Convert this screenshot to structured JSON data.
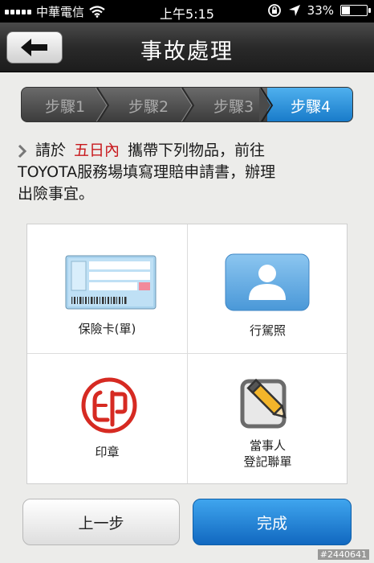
{
  "status_bar": {
    "carrier": "中華電信",
    "time": "上午5:15",
    "battery": "33%",
    "battery_level": 0.33
  },
  "navbar": {
    "title": "事故處理",
    "back_icon": "arrow-left-icon"
  },
  "steps": [
    {
      "label": "步驟1",
      "active": false
    },
    {
      "label": "步驟2",
      "active": false
    },
    {
      "label": "步驟3",
      "active": false
    },
    {
      "label": "步驟4",
      "active": true
    }
  ],
  "instruction": {
    "prefix": "請於",
    "highlight": "五日內",
    "after": "攜帶下列物品，前往",
    "line2": "TOYOTA服務場填寫理賠申請書，辦理",
    "line3": "出險事宜。",
    "highlight_color": "#c8191d"
  },
  "items": [
    {
      "label": "保險卡(單)",
      "icon": "insurance-card-icon"
    },
    {
      "label": "行駕照",
      "icon": "driver-license-icon"
    },
    {
      "label": "印章",
      "icon": "seal-stamp-icon"
    },
    {
      "label_line1": "當事人",
      "label_line2": "登記聯單",
      "icon": "edit-form-icon"
    }
  ],
  "buttons": {
    "prev_label": "上一步",
    "done_label": "完成"
  },
  "watermark": "#2440641",
  "colors": {
    "accent": "#1a7fd0",
    "nav_bg": "#2a2a2a"
  }
}
